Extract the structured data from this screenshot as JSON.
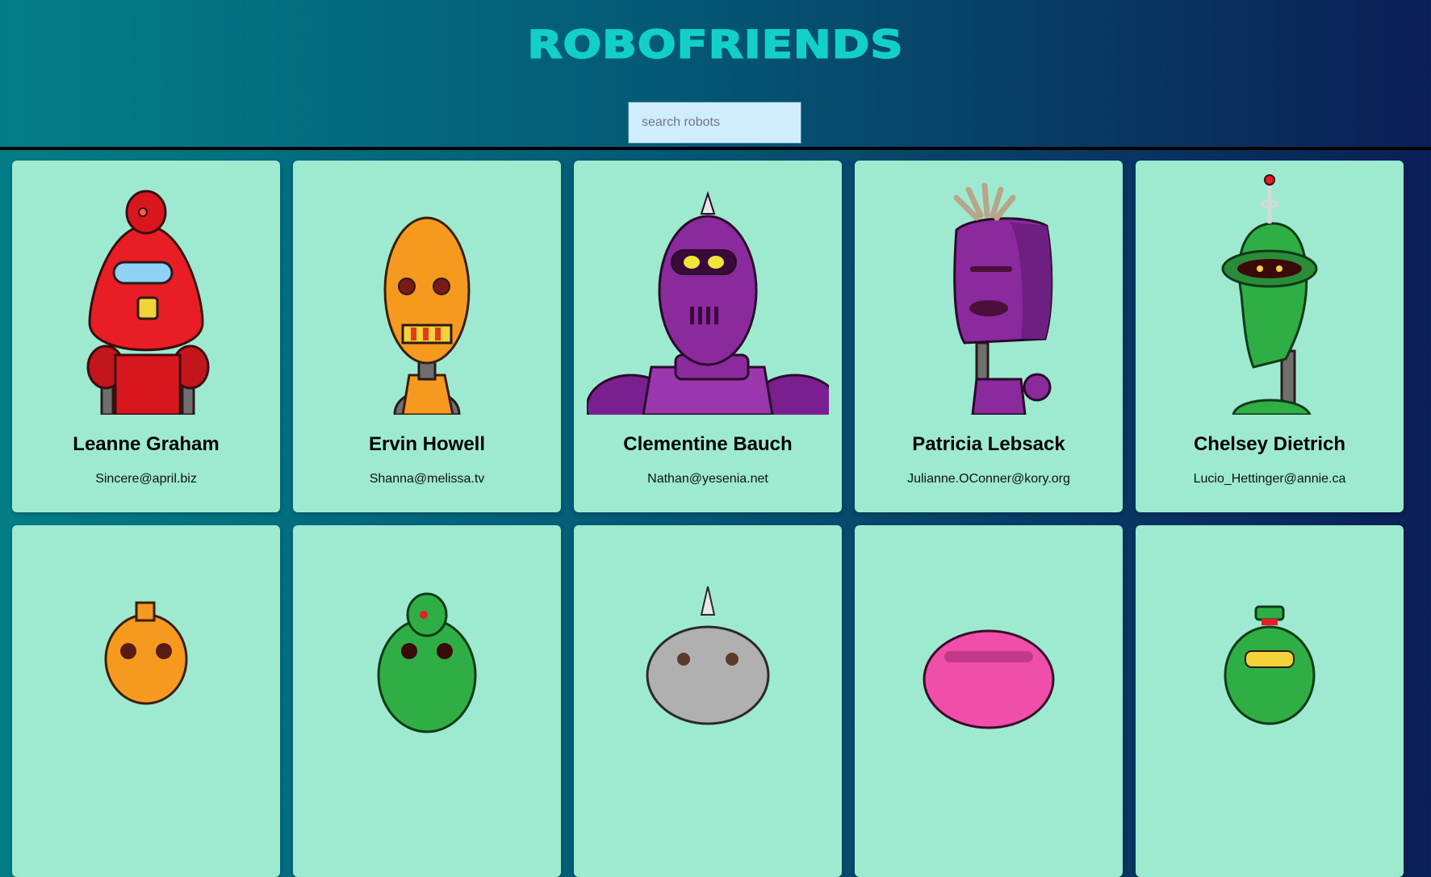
{
  "app": {
    "title": "ROBOFRIENDS"
  },
  "search": {
    "placeholder": "search robots",
    "value": ""
  },
  "robots": [
    {
      "name": "Leanne Graham",
      "email": "Sincere@april.biz",
      "color": "#e81d25",
      "icon": "red-robot"
    },
    {
      "name": "Ervin Howell",
      "email": "Shanna@melissa.tv",
      "color": "#f59a1f",
      "icon": "orange-robot"
    },
    {
      "name": "Clementine Bauch",
      "email": "Nathan@yesenia.net",
      "color": "#8a2a9c",
      "icon": "purple-spike-robot"
    },
    {
      "name": "Patricia Lebsack",
      "email": "Julianne.OConner@kory.org",
      "color": "#8a2a9c",
      "icon": "purple-box-robot"
    },
    {
      "name": "Chelsey Dietrich",
      "email": "Lucio_Hettinger@annie.ca",
      "color": "#2fae46",
      "icon": "green-antenna-robot"
    }
  ],
  "robots_row2": [
    {
      "color": "#f59a1f",
      "icon": "orange-robot"
    },
    {
      "color": "#2fae46",
      "icon": "green-robot"
    },
    {
      "color": "#b0b0b0",
      "icon": "grey-spike-robot"
    },
    {
      "color": "#ef4fa8",
      "icon": "pink-robot"
    },
    {
      "color": "#2fae46",
      "icon": "green-hat-robot"
    }
  ],
  "colors": {
    "card_bg": "#9eead0",
    "title": "#12d0c8",
    "search_bg": "#d1ecfd"
  }
}
